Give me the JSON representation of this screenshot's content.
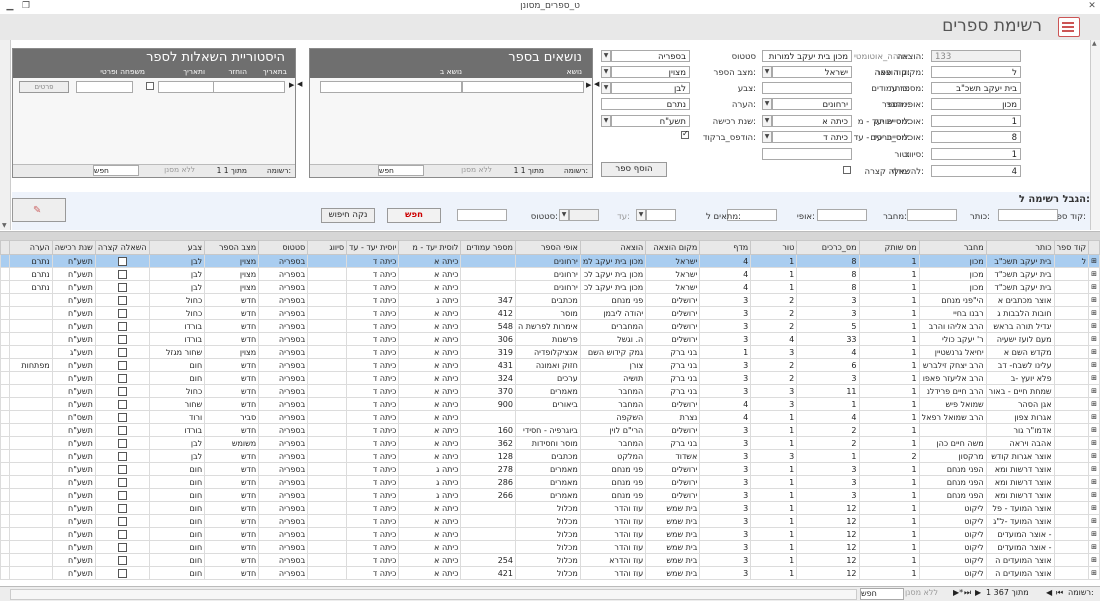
{
  "window": {
    "title": "ט_ספרים_מסונן"
  },
  "form": {
    "title": "רשימת ספרים"
  },
  "fields": {
    "id": {
      "label": "מזהה_אוטומטי:",
      "value": "133"
    },
    "code": {
      "label": "קוד ספר:",
      "value": "ל"
    },
    "title": {
      "label": "כותר:",
      "value": "בית יעקב תשכ\"ב"
    },
    "author": {
      "label": "מחבר:",
      "value": "מכון"
    },
    "place": {
      "label": "מס שותק:",
      "value": "1"
    },
    "volumes": {
      "label": "מס_כרכים:",
      "value": "8"
    },
    "series": {
      "label": "טור:",
      "value": "1"
    },
    "shelf": {
      "label": "מדף:",
      "value": "4"
    },
    "publisher": {
      "label": "הוצאה:",
      "value": "מכון בית יעקב למורות"
    },
    "pub_place": {
      "label": "מקום הוצאה:",
      "value": "ישראל"
    },
    "pages": {
      "label": "מספר עמודים:",
      "value": ""
    },
    "book_type": {
      "label": "אופי הספר:",
      "value": "ירחונים"
    },
    "aud_from": {
      "label": "אוכלוסיית יעד - מ:",
      "value": "כיתה א"
    },
    "aud_to": {
      "label": "אוכלוסיית יעד - עד:",
      "value": "כיתה ד"
    },
    "note_series": {
      "label": "סיווג:",
      "value": ""
    },
    "short_loan": {
      "label": "להשאלה קצרה:"
    },
    "status": {
      "label": "סטטוס",
      "value": "בספריה"
    },
    "condition": {
      "label": "מצב הספר:",
      "value": "מצוין"
    },
    "color": {
      "label": "צבע:",
      "value": "לבן"
    },
    "remark": {
      "label": "הערה:",
      "value": "נתרם"
    },
    "year": {
      "label": "שנת רכישה:",
      "value": "תשע\"ח"
    },
    "printed": {
      "label": "הודפס_ברקוד:"
    },
    "add_book": "הוסף ספר"
  },
  "subjects": {
    "title": "נושאים בספר",
    "col_subject": "נושא",
    "col_sub": "נושא ב",
    "nav_record": "רשומה:",
    "nav_count": "1 מתוך 1",
    "nav_filter": "ללא מסנן",
    "nav_search": "חפש"
  },
  "history": {
    "title": "היסטוריית השאלות לספר",
    "col_date": "בתאריך",
    "col_returned": "הוחזר",
    "col_return_date": "ותאריך",
    "col_borrower": "משפחה ופרטי",
    "details_btn": "פרטים",
    "nav_record": "רשומה:",
    "nav_count": "1 מתוך 1",
    "nav_filter": "ללא מסנן",
    "nav_search": "חפש"
  },
  "filter": {
    "title": "הגבל רשימה ל:",
    "code": "קוד ספר:",
    "title_lbl": "כותר:",
    "author": "מחבר:",
    "type": "אופי:",
    "matches": "מתאים ל:",
    "to": "עד:",
    "status": "סטטוס:",
    "search_btn": "חפש",
    "clear_btn": "נקה חיפוש"
  },
  "grid": {
    "columns": [
      "קוד ספר",
      "כותר",
      "מחבר",
      "מס שותק",
      "מס_כרכים",
      "טור",
      "מדף",
      "מקום הוצאה",
      "הוצאה",
      "אופי הספר",
      "מספר עמודים",
      "לוסית יעד - מ",
      "יוסית יעד - עד",
      "סיווג",
      "סטטוס",
      "מצב הספר",
      "צבע",
      "השאלה קצרה",
      "שנת רכישה",
      "הערה"
    ],
    "rows": [
      [
        "ל",
        "בית יעקב תשכ\"ב",
        "מכון",
        "1",
        "8",
        "1",
        "4",
        "ישראל",
        "מכון בית יעקב למ",
        "ירחונים",
        "",
        "כיתה א",
        "כיתה ד",
        "",
        "בספריה",
        "מצוין",
        "לבן",
        "",
        "תשע\"ח",
        "נתרם"
      ],
      [
        "",
        "בית יעקב תשכ\"ד",
        "מכון",
        "1",
        "8",
        "1",
        "4",
        "ישראל",
        "מכון בית יעקב לכ",
        "ירחונים",
        "",
        "כיתה א",
        "כיתה ד",
        "",
        "בספריה",
        "מצוין",
        "לבן",
        "",
        "תשע\"ח",
        "נתרם"
      ],
      [
        "",
        "בית יעקב תשכ\"ד",
        "מכון",
        "1",
        "8",
        "1",
        "4",
        "ישראל",
        "מכון בית יעקב לכ",
        "ירחונים",
        "",
        "כיתה א",
        "כיתה ד",
        "",
        "בספריה",
        "מצוין",
        "לבן",
        "",
        "תשע\"ח",
        "נתרם"
      ],
      [
        "",
        "אוצר מכתבים א",
        "הי\"פני מנחם",
        "1",
        "3",
        "2",
        "3",
        "ירושלים",
        "פני מנחם",
        "מכתבים",
        "347",
        "כיתה ג",
        "כיתה ד",
        "",
        "בספריה",
        "חדש",
        "כחול",
        "",
        "תשע\"ח",
        ""
      ],
      [
        "",
        "חובות הלבבות ג",
        "רבנו בחיי",
        "1",
        "3",
        "2",
        "3",
        "ירושלים",
        "יהודה ליבמן",
        "מוסר",
        "412",
        "כיתה א",
        "כיתה ד",
        "",
        "בספריה",
        "חדש",
        "כחול",
        "",
        "תשע\"ח",
        ""
      ],
      [
        "",
        "יגדיל תורה בראש",
        "הרב אליהו והרב",
        "1",
        "5",
        "2",
        "3",
        "ירושלים",
        "המחברים",
        "אימרות לפרשת ה",
        "548",
        "כיתה א",
        "כיתה ד",
        "",
        "בספריה",
        "חדש",
        "בורדו",
        "",
        "תשע\"ח",
        ""
      ],
      [
        "",
        "מעם לועז ישעיה",
        "ר' יעקב כולי",
        "1",
        "33",
        "4",
        "3",
        "ירושלים",
        "ה. וגשל",
        "פרשנות",
        "306",
        "כיתה א",
        "כיתה ד",
        "",
        "בספריה",
        "חדש",
        "בורדו",
        "",
        "תשע\"ח",
        ""
      ],
      [
        "",
        "מקדש השם א",
        "יחיאל גרנשטיין",
        "1",
        "4",
        "3",
        "1",
        "בני ברק",
        "גמק קידוש השם",
        "אנציקלופדיה",
        "319",
        "כיתה א",
        "כיתה ד",
        "",
        "בספריה",
        "מצוין",
        "שחור מגזל",
        "",
        "תשע\"ג",
        ""
      ],
      [
        "",
        "עלינו לשבח- דב",
        "הרב יצחק זילברש",
        "1",
        "6",
        "2",
        "3",
        "בני ברק",
        "צורן",
        "חזוק ואמונה",
        "431",
        "כיתה א",
        "כיתה ד",
        "",
        "בספריה",
        "חדש",
        "חום",
        "",
        "תשע\"ח",
        "מפתחות"
      ],
      [
        "",
        "פלא יועץ -ב",
        "הרב אליעזר פאפו",
        "1",
        "3",
        "2",
        "3",
        "בני ברק",
        "תושיה",
        "ערכים",
        "324",
        "כיתה א",
        "כיתה ד",
        "",
        "בספריה",
        "חדש",
        "חום",
        "",
        "תשע\"ח",
        ""
      ],
      [
        "",
        "שמחת חיים - באור",
        "הרב חיים פרידלנ",
        "1",
        "11",
        "3",
        "3",
        "בני ברק",
        "המחבר",
        "מאמרים",
        "370",
        "כיתה א",
        "כיתה ד",
        "",
        "בספריה",
        "חדש",
        "כחול",
        "",
        "תשע\"ח",
        ""
      ],
      [
        "",
        "אגן הסהר",
        "שמואל פיש",
        "1",
        "1",
        "3",
        "4",
        "ירושלים",
        "המחבר",
        "ביאורים",
        "900",
        "כיתה א",
        "כיתה ד",
        "",
        "בספריה",
        "חדש",
        "שחור",
        "",
        "תשע\"ח",
        ""
      ],
      [
        "",
        "אגרות צפון",
        "הרב שמואל רפאל",
        "1",
        "4",
        "1",
        "4",
        "נצרת",
        "השקפה",
        "",
        "",
        "כיתה א",
        "כיתה ד",
        "",
        "בספריה",
        "סביר",
        "ורוד",
        "",
        "תשס\"ח",
        ""
      ],
      [
        "",
        "אדמו\"ר גור",
        "",
        "1",
        "2",
        "1",
        "3",
        "ירושלים",
        "הרי\"ם לוין",
        "ביוגרפיה - חסידי",
        "160",
        "כיתה א",
        "כיתה ד",
        "",
        "בספריה",
        "חדש",
        "בורדו",
        "",
        "תשע\"ח",
        ""
      ],
      [
        "",
        "אהבה ויראה",
        "משה חיים כהן",
        "1",
        "2",
        "1",
        "3",
        "בני ברק",
        "המחבר",
        "מוסר וחסידות",
        "362",
        "כיתה א",
        "כיתה ד",
        "",
        "בספריה",
        "משומש",
        "לבן",
        "",
        "תשע\"ח",
        ""
      ],
      [
        "",
        "אוצר אגרות קודש",
        "מרקסון",
        "2",
        "1",
        "3",
        "3",
        "אשדוד",
        "המלקט",
        "מכתבים",
        "128",
        "כיתה א",
        "כיתה ד",
        "",
        "בספריה",
        "חדש",
        "לבן",
        "",
        "תשע\"ח",
        ""
      ],
      [
        "",
        "אוצר דרשות ומא",
        "הפני מנחם",
        "1",
        "3",
        "1",
        "3",
        "ירושלים",
        "פני מנחם",
        "מאמרים",
        "278",
        "כיתה ג",
        "כיתה ד",
        "",
        "בספריה",
        "חדש",
        "חום",
        "",
        "תשע\"ח",
        ""
      ],
      [
        "",
        "אוצר דרשות ומא",
        "הפני מנחם",
        "1",
        "3",
        "1",
        "3",
        "ירושלים",
        "פני מנחם",
        "מאמרים",
        "286",
        "כיתה ג",
        "כיתה ד",
        "",
        "בספריה",
        "חדש",
        "חום",
        "",
        "תשע\"ח",
        ""
      ],
      [
        "",
        "אוצר דרשות ומא",
        "הפני מנחם",
        "1",
        "3",
        "1",
        "3",
        "ירושלים",
        "פני מנחם",
        "מאמרים",
        "266",
        "כיתה ג",
        "כיתה ד",
        "",
        "בספריה",
        "חדש",
        "חום",
        "",
        "תשע\"ח",
        ""
      ],
      [
        "",
        "אוצר המועד - פל",
        "ליקוט",
        "1",
        "12",
        "1",
        "3",
        "בית שמש",
        "עוז והדר",
        "מכלול",
        "",
        "כיתה א",
        "כיתה ד",
        "",
        "בספריה",
        "חדש",
        "חום",
        "",
        "תשע\"ח",
        ""
      ],
      [
        "",
        "אוצר המועד -ל\"ג",
        "ליקוט",
        "1",
        "12",
        "1",
        "3",
        "בית שמש",
        "עוז והדר",
        "מכלול",
        "",
        "כיתה א",
        "כיתה ד",
        "",
        "בספריה",
        "חדש",
        "חום",
        "",
        "תשע\"ח",
        ""
      ],
      [
        "",
        "אוצר המועדים -",
        "ליקוט",
        "1",
        "12",
        "1",
        "3",
        "בית שמש",
        "עוז והדר",
        "מכלול",
        "",
        "כיתה א",
        "כיתה ד",
        "",
        "בספריה",
        "חדש",
        "חום",
        "",
        "תשע\"ח",
        ""
      ],
      [
        "",
        "אוצר המועדים -",
        "ליקוט",
        "1",
        "12",
        "1",
        "3",
        "בית שמש",
        "עוז והדר",
        "מכלול",
        "",
        "כיתה א",
        "כיתה ד",
        "",
        "בספריה",
        "חדש",
        "חום",
        "",
        "תשע\"ח",
        ""
      ],
      [
        "",
        "אוצר המועדים ה",
        "ליקוט",
        "1",
        "12",
        "1",
        "3",
        "בית שמש",
        "עוז והדרא",
        "מכלול",
        "254",
        "כיתה א",
        "כיתה ד",
        "",
        "בספריה",
        "חדש",
        "חום",
        "",
        "תשע\"ח",
        ""
      ],
      [
        "",
        "אוצר המועדים ה",
        "ליקוט",
        "1",
        "12",
        "1",
        "3",
        "בית שמש",
        "עוז והדר",
        "מכלול",
        "421",
        "כיתה א",
        "כיתה ד",
        "",
        "בספריה",
        "חדש",
        "חום",
        "",
        "תשע\"ח",
        ""
      ]
    ]
  },
  "bottom": {
    "record_label": "רשומה:",
    "record_count": "1 מתוך 367",
    "filter_label": "ללא מסנן",
    "search_label": "חפש"
  }
}
